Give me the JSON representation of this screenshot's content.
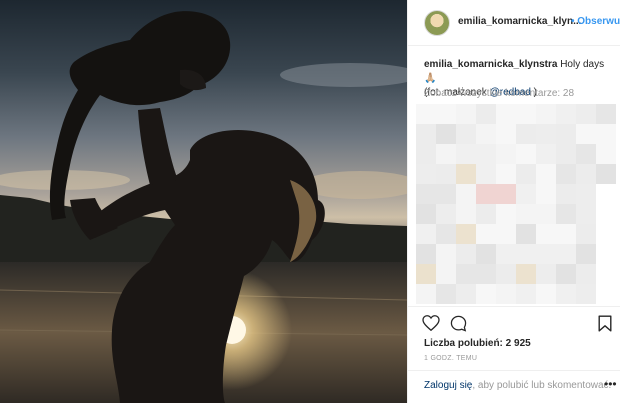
{
  "post": {
    "username": "emilia_komarnicka_klyn...",
    "follow_label": "• Obserwuj",
    "caption_user": "emilia_komarnicka_klynstra",
    "caption_text": "Holy days🙏🏼",
    "caption_line2_prefix": "(fot. małżonek ",
    "caption_mention": "@redbad",
    "caption_line2_suffix": " )",
    "view_all_comments": "Zobacz wszystkie komentarze: 28",
    "likes": "Liczba polubień: 2 925",
    "timestamp": "1 GODZ. TEMU",
    "login_link": "Zaloguj się",
    "login_text": ", aby polubić lub skomentować.",
    "more_label": "•••"
  },
  "icons": {
    "like": "heart-icon",
    "comment": "comment-icon",
    "save": "bookmark-icon",
    "more": "more-options-icon"
  },
  "colors": {
    "link": "#3897f0",
    "mention": "#003569",
    "muted": "#999999"
  }
}
